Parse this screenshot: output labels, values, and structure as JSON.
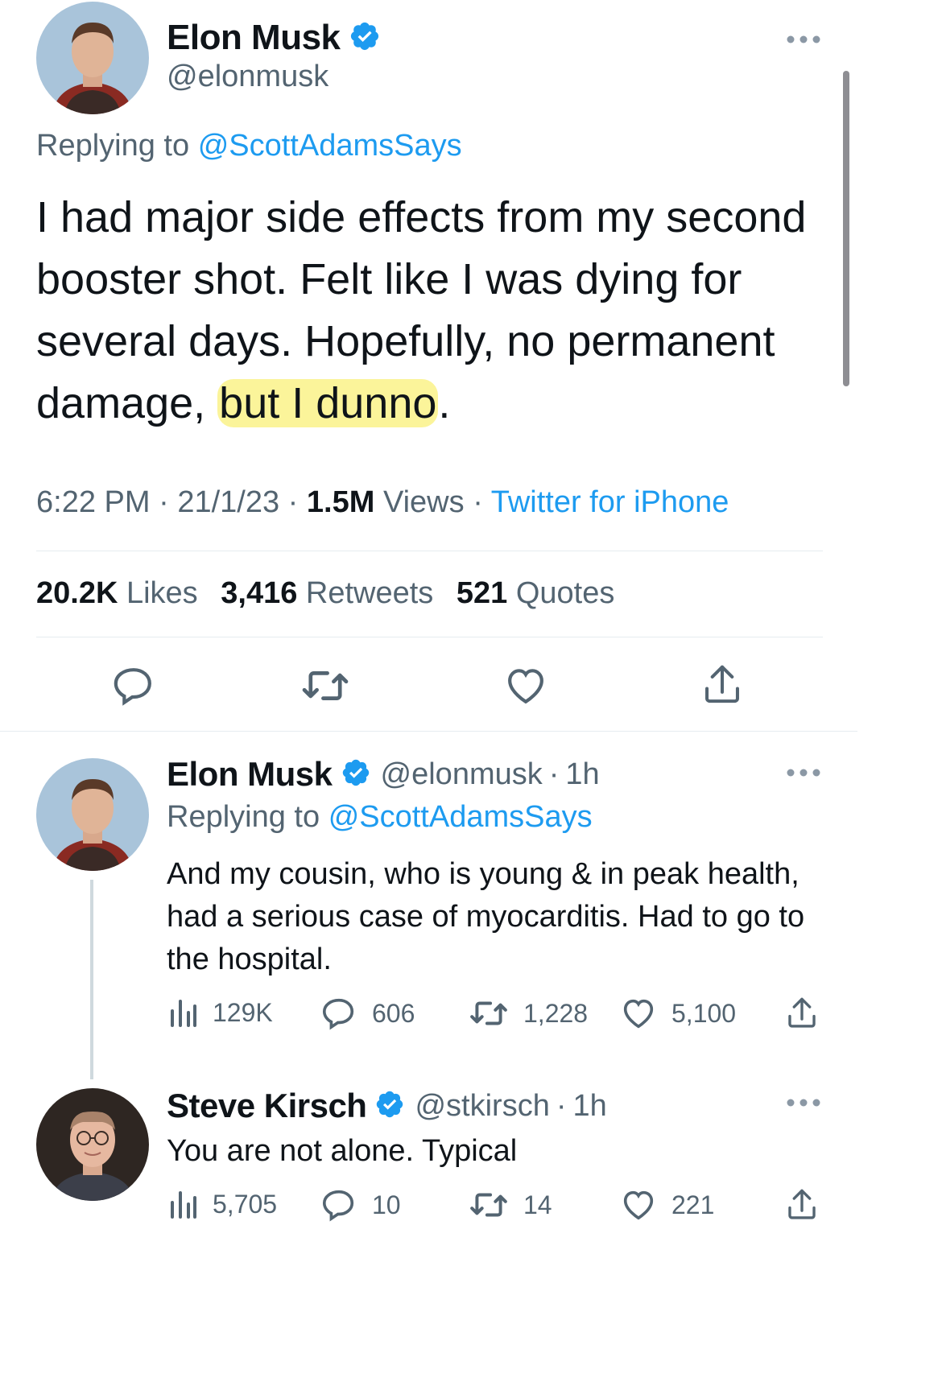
{
  "main_tweet": {
    "author_name": "Elon Musk",
    "handle": "@elonmusk",
    "replying_prefix": "Replying to",
    "replying_to": "@ScottAdamsSays",
    "text_before_highlight": "I had major side effects from my second booster shot. Felt like I was dying for several days. Hopefully, no permanent damage, ",
    "text_highlight": "but I dunno",
    "text_after_highlight": ".",
    "time": "6:22 PM",
    "date": "21/1/23",
    "views_count": "1.5M",
    "views_label": "Views",
    "source": "Twitter for iPhone",
    "likes_count": "20.2K",
    "likes_label": "Likes",
    "retweets_count": "3,416",
    "retweets_label": "Retweets",
    "quotes_count": "521",
    "quotes_label": "Quotes",
    "more_icon": "more-horizontal-icon"
  },
  "reply1": {
    "author_name": "Elon Musk",
    "handle": "@elonmusk",
    "age": "1h",
    "replying_prefix": "Replying to",
    "replying_to": "@ScottAdamsSays",
    "text": "And my cousin, who is young & in peak health, had a serious case of myocarditis. Had to go to the hospital.",
    "views": "129K",
    "replies": "606",
    "retweets": "1,228",
    "likes": "5,100"
  },
  "reply2": {
    "author_name": "Steve Kirsch",
    "handle": "@stkirsch",
    "age": "1h",
    "text": "You are not alone. Typical",
    "views": "5,705",
    "replies": "10",
    "retweets": "14",
    "likes": "221"
  },
  "separator": "·",
  "colors": {
    "accent": "#1d9bf0",
    "text": "#0f1419",
    "secondary": "#536471",
    "highlight": "#faf078"
  }
}
